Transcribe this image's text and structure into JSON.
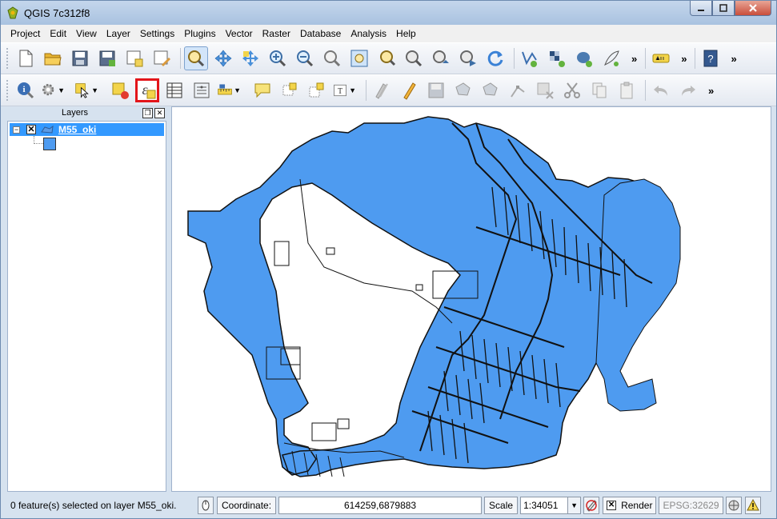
{
  "window": {
    "title": "QGIS 7c312f8"
  },
  "menu": [
    "Project",
    "Edit",
    "View",
    "Layer",
    "Settings",
    "Plugins",
    "Vector",
    "Raster",
    "Database",
    "Analysis",
    "Help"
  ],
  "toolbar_overflow": "»",
  "layers_panel": {
    "title": "Layers",
    "layers": [
      {
        "name": "M55_oki",
        "visible": true,
        "fill_color": "#4e9bf0"
      }
    ]
  },
  "status": {
    "message": "0 feature(s) selected on layer M55_oki.",
    "coordinate_label": "Coordinate:",
    "coordinate_value": "614259,6879883",
    "scale_label": "Scale",
    "scale_value": "1:34051",
    "render_label": "Render",
    "crs": "EPSG:32629"
  },
  "colors": {
    "highlight_border": "#e3151a",
    "polygon_fill": "#4e9bf0",
    "selection": "#3399ff"
  }
}
